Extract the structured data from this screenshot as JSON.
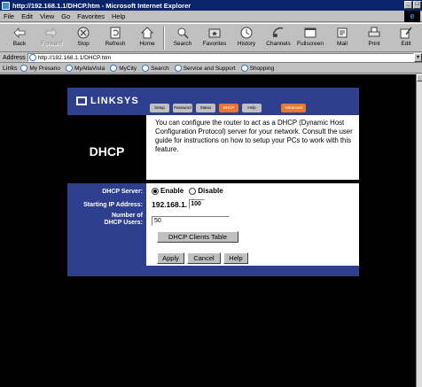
{
  "window": {
    "title": "http://192.168.1.1/DHCP.htm - Microsoft Internet Explorer"
  },
  "menu": [
    "File",
    "Edit",
    "View",
    "Go",
    "Favorites",
    "Help"
  ],
  "toolbar": {
    "back": "Back",
    "forward": "Forward",
    "stop": "Stop",
    "refresh": "Refresh",
    "home": "Home",
    "search": "Search",
    "favorites": "Favorites",
    "history": "History",
    "channels": "Channels",
    "fullscreen": "Fullscreen",
    "mail": "Mail",
    "print": "Print",
    "edit": "Edit"
  },
  "address": {
    "label": "Address",
    "url": "http://192.168.1.1/DHCP.htm"
  },
  "links": {
    "label": "Links",
    "items": [
      "My Presario",
      "MyAltaVista",
      "MyCity",
      "Search",
      "Service and Support",
      "Shopping"
    ]
  },
  "router": {
    "brand": "LINKSYS",
    "tabs": [
      "Setup",
      "Password",
      "Status",
      "DHCP",
      "Help"
    ],
    "advanced_tab": "Advanced",
    "page_title": "DHCP",
    "description": "You can configure the router to act as a DHCP (Dynamic Host Configuration Protocol) server for your network. Consult the user guide for instructions on how to setup your PCs to work with this feature.",
    "labels": {
      "server": "DHCP Server:",
      "starting_ip": "Starting IP Address:",
      "num_users_1": "Number of",
      "num_users_2": "DHCP Users:"
    },
    "server_enable": "Enable",
    "server_disable": "Disable",
    "ip_prefix": "192.168.1.",
    "ip_last_octet": "100",
    "num_users": "50",
    "clients_table_button": "DHCP Clients Table",
    "apply_button": "Apply",
    "cancel_button": "Cancel",
    "help_button": "Help"
  }
}
